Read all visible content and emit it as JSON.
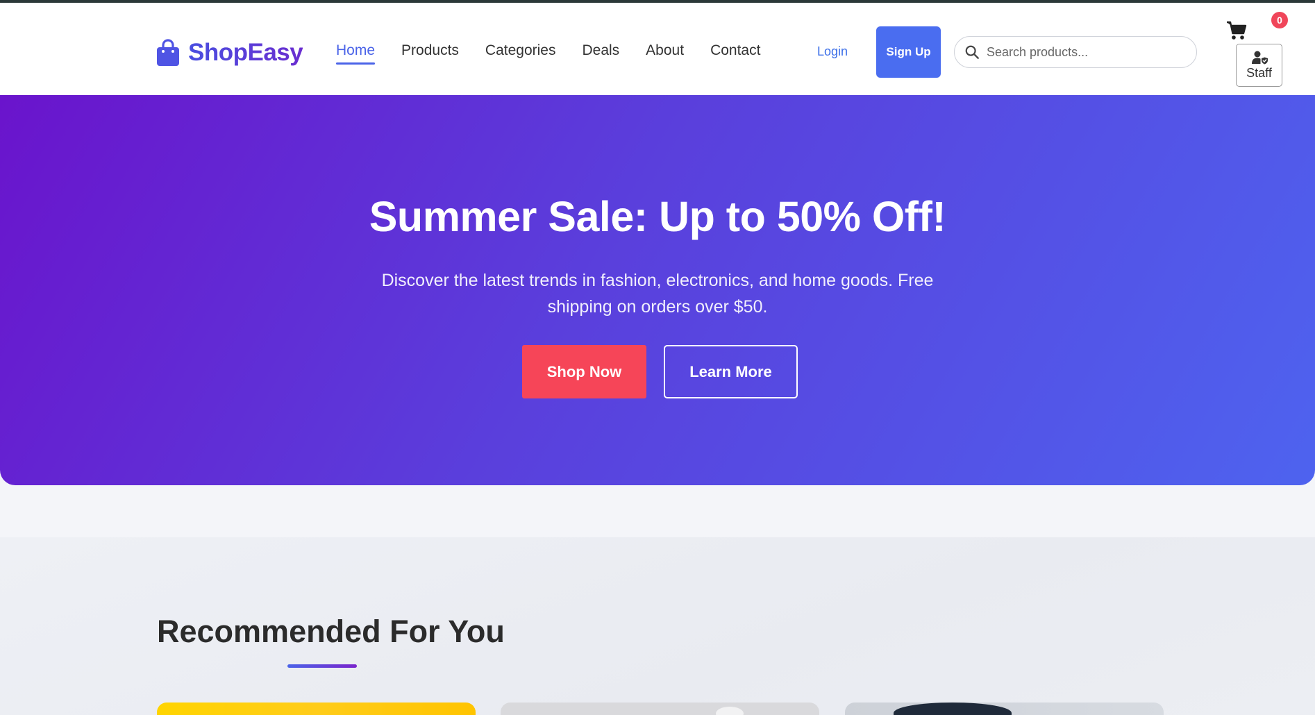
{
  "brand": {
    "name": "ShopEasy",
    "icon": "shopping-bag-icon",
    "color": "#5b3fd6"
  },
  "nav": {
    "items": [
      {
        "label": "Home",
        "active": true
      },
      {
        "label": "Products",
        "active": false
      },
      {
        "label": "Categories",
        "active": false
      },
      {
        "label": "Deals",
        "active": false
      },
      {
        "label": "About",
        "active": false
      },
      {
        "label": "Contact",
        "active": false
      }
    ]
  },
  "auth": {
    "login_label": "Login",
    "signup_label": "Sign Up"
  },
  "search": {
    "placeholder": "Search products..."
  },
  "cart": {
    "icon": "cart-icon",
    "count": "0"
  },
  "staff": {
    "label": "Staff",
    "icon": "user-shield-icon"
  },
  "hero": {
    "title": "Summer Sale: Up to 50% Off!",
    "subtitle": "Discover the latest trends in fashion, electronics, and home goods. Free shipping on orders over $50.",
    "primary_cta": "Shop Now",
    "secondary_cta": "Learn More"
  },
  "recommended": {
    "title": "Recommended For You"
  },
  "colors": {
    "accent": "#4a63e8",
    "hero_gradient_start": "#6a14cc",
    "hero_gradient_end": "#4e63ef",
    "cta_red": "#f64558",
    "badge_red": "#f0465a"
  }
}
